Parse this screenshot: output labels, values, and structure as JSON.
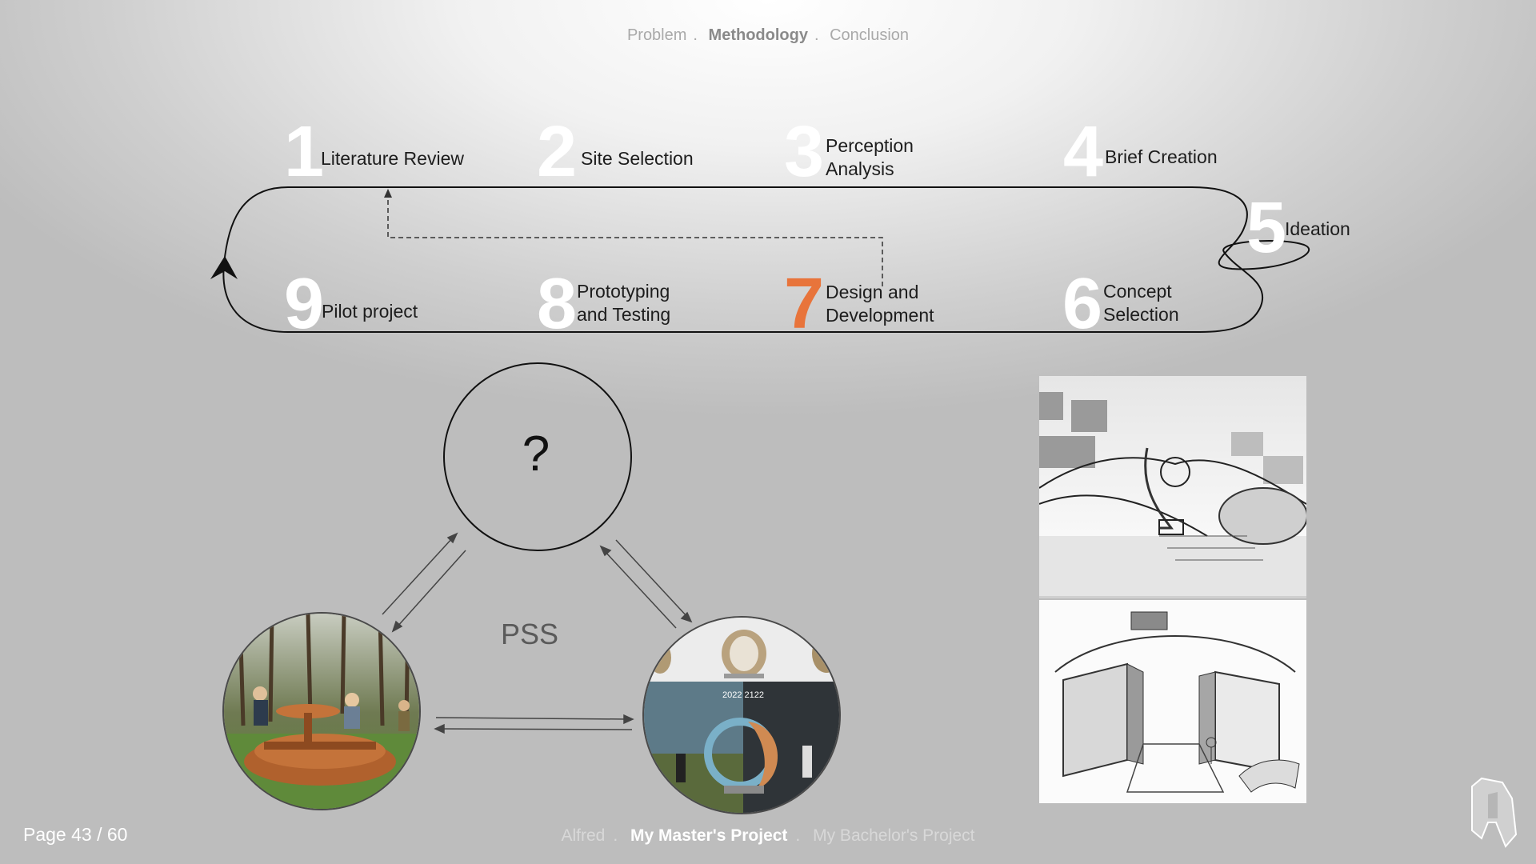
{
  "header_nav": {
    "items": [
      "Problem",
      "Methodology",
      "Conclusion"
    ],
    "current": "Methodology",
    "separator": "."
  },
  "steps": [
    {
      "number": "1",
      "label": "Literature Review"
    },
    {
      "number": "2",
      "label": "Site Selection"
    },
    {
      "number": "3",
      "label_line1": "Perception",
      "label_line2": "Analysis"
    },
    {
      "number": "4",
      "label": "Brief Creation"
    },
    {
      "number": "5",
      "label": "Ideation"
    },
    {
      "number": "6",
      "label_line1": "Concept",
      "label_line2": "Selection"
    },
    {
      "number": "7",
      "label_line1": "Design and",
      "label_line2": "Development",
      "active": true
    },
    {
      "number": "8",
      "label_line1": "Prototyping",
      "label_line2": "and Testing"
    },
    {
      "number": "9",
      "label": "Pilot project"
    }
  ],
  "pss_diagram": {
    "center_label": "PSS",
    "question_mark": "?",
    "photo_right_text": "2022 2122"
  },
  "footer": {
    "page_label": "Page 43 / 60",
    "nav_items": [
      "Alfred",
      "My Master's Project",
      "My Bachelor's Project"
    ],
    "nav_current": "My Master's Project",
    "separator": "."
  },
  "colors": {
    "accent": "#e8743b",
    "step_number": "#ffffff",
    "text": "#1d1d1d"
  },
  "icons": [
    "cycle-arrow-icon",
    "dashed-return-arrow-icon",
    "bidirectional-arrows-icon",
    "alfred-logo-icon"
  ]
}
